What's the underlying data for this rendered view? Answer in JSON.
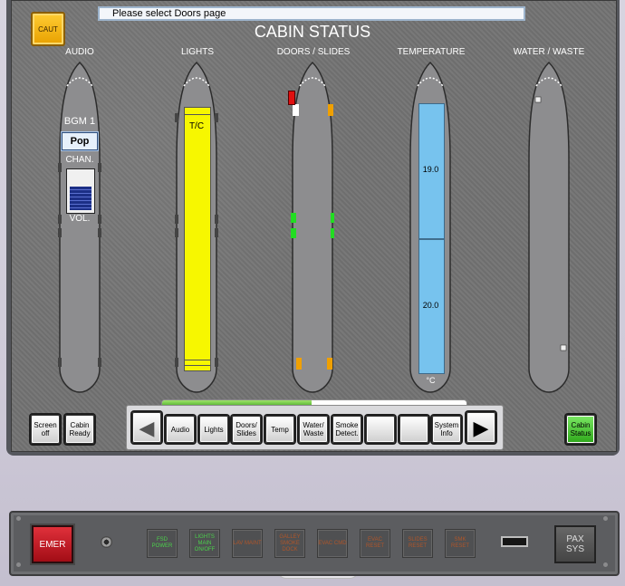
{
  "header": {
    "caution_label": "CAUT",
    "message": "Please select Doors page",
    "title": "CABIN STATUS"
  },
  "columns": {
    "audio": "AUDIO",
    "lights": "LIGHTS",
    "doors": "DOORS / SLIDES",
    "temperature": "TEMPERATURE",
    "water": "WATER / WASTE"
  },
  "audio": {
    "program": "BGM 1",
    "channel_value": "Pop",
    "channel_label": "CHAN.",
    "volume_label": "VOL.",
    "volume_level": 0.6
  },
  "lights": {
    "zone_label": "T/C"
  },
  "temperature": {
    "zone_fwd": "19.0",
    "zone_aft": "20.0",
    "unit": "°C"
  },
  "bottom_left": {
    "screen_off": "Screen off",
    "cabin_ready": "Cabin Ready"
  },
  "tabs": [
    {
      "label": "Audio"
    },
    {
      "label": "Lights"
    },
    {
      "label": "Doors/ Slides"
    },
    {
      "label": "Temp"
    },
    {
      "label": "Water/ Waste"
    },
    {
      "label": "Smoke Detect."
    },
    {
      "label": ""
    },
    {
      "label": ""
    },
    {
      "label": "System Info"
    }
  ],
  "page_progress": 0.49,
  "cabin_status_button": "Cabin Status",
  "lower_panel": {
    "emer": "EMER",
    "buttons": [
      {
        "label": "FSD POWER",
        "color": "#4cd14c"
      },
      {
        "label": "LIGHTS MAIN ON/OFF",
        "color": "#4cd14c"
      },
      {
        "label": "LAV MAINT",
        "color": "#b0562a"
      },
      {
        "label": "GALLEY SMOKE DOCK",
        "color": "#b0562a"
      },
      {
        "label": "EVAC CMD",
        "color": "#b0562a"
      },
      {
        "label": "EVAC RESET",
        "color": "#b0562a"
      },
      {
        "label": "SLIDES RESET",
        "color": "#b0562a"
      },
      {
        "label": "SMK RESET",
        "color": "#b0562a"
      }
    ],
    "pax_sys": "PAX SYS"
  }
}
